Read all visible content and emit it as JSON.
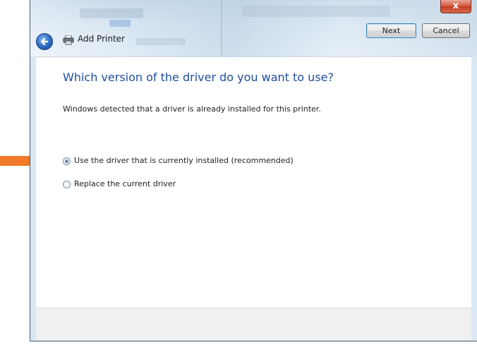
{
  "window": {
    "title": "Add Printer",
    "close_glyph": "x",
    "icons": {
      "back": "back-arrow-icon",
      "printer": "printer-icon",
      "close": "close-icon"
    }
  },
  "content": {
    "heading": "Which version of the driver do you want to use?",
    "subtext": "Windows detected that a driver is already installed for this printer.",
    "options": [
      {
        "label": "Use the driver that is currently installed (recommended)",
        "selected": true
      },
      {
        "label": "Replace the current driver",
        "selected": false
      }
    ]
  },
  "buttons": {
    "next": "Next",
    "cancel": "Cancel"
  },
  "colors": {
    "heading": "#1f4ea0",
    "annotation_arrow": "#f07a2a",
    "close": "#c9432a"
  }
}
